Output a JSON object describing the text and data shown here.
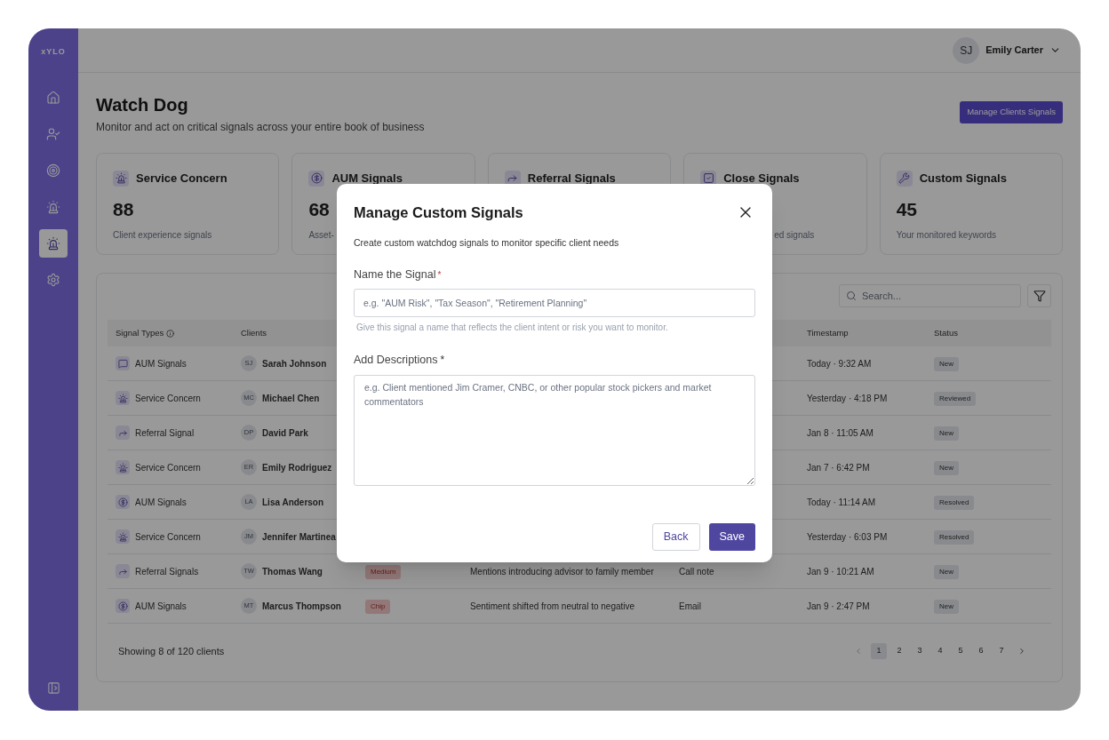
{
  "logo": "xYLO",
  "sidebar": {
    "items": [
      {
        "kind": "home",
        "selected": false
      },
      {
        "kind": "user",
        "selected": false
      },
      {
        "kind": "target",
        "selected": false
      },
      {
        "kind": "siren",
        "selected": false
      },
      {
        "kind": "siren",
        "selected": true
      },
      {
        "kind": "settings",
        "selected": false
      }
    ]
  },
  "user": {
    "initials": "SJ",
    "name": "Emily Carter"
  },
  "page": {
    "title": "Watch Dog",
    "subtitle": "Monitor and act on critical signals across your entire book of business",
    "action": "Manage Clients Signals"
  },
  "cards": [
    {
      "kind": "siren",
      "title": "Service Concern",
      "value": "88",
      "subtitle": "Client experience signals"
    },
    {
      "kind": "dollar",
      "title": "AUM Signals",
      "value": "68",
      "subtitle": "Asset-"
    },
    {
      "kind": "forward",
      "title": "Referral Signals"
    },
    {
      "kind": "square",
      "title": "Close Signals",
      "subtitle": "ed signals"
    },
    {
      "kind": "wrench",
      "title": "Custom Signals",
      "value": "45",
      "subtitle": "Your monitored keywords"
    }
  ],
  "table": {
    "search": {
      "placeholder": "Search..."
    },
    "columns": [
      {
        "label": "Signal Types"
      },
      {
        "label": "Clients"
      },
      {
        "label": "Timestamp"
      },
      {
        "label": "Status"
      }
    ],
    "rows": [
      {
        "signal": {
          "kind": "chat",
          "label": "AUM Signals"
        },
        "initials": "SJ",
        "client": "Sarah Johnson",
        "timestamp": "Today · 9:32 AM",
        "status": "New"
      },
      {
        "signal": {
          "kind": "siren",
          "label": "Service Concern"
        },
        "initials": "MC",
        "client": "Michael Chen",
        "timestamp": "Yesterday · 4:18 PM",
        "status": "Reviewed"
      },
      {
        "signal": {
          "kind": "forward",
          "label": "Referral Signal"
        },
        "initials": "DP",
        "client": "David Park",
        "timestamp": "Jan 8 · 11:05 AM",
        "status": "New"
      },
      {
        "signal": {
          "kind": "siren",
          "label": "Service Concern"
        },
        "initials": "ER",
        "client": "Emily Rodriguez",
        "timestamp": "Jan 7 · 6:42 PM",
        "status": "New"
      },
      {
        "signal": {
          "kind": "dollar",
          "label": "AUM Signals"
        },
        "initials": "LA",
        "client": "Lisa Anderson",
        "timestamp": "Today · 11:14 AM",
        "status": "Resolved"
      },
      {
        "signal": {
          "kind": "siren",
          "label": "Service Concern"
        },
        "initials": "JM",
        "client": "Jennifer Martinea",
        "timestamp": "Yesterday · 6:03 PM",
        "status": "Resolved"
      },
      {
        "signal": {
          "kind": "forward",
          "label": "Referral Signals"
        },
        "initials": "TW",
        "client": "Thomas Wang",
        "chip": "Medium",
        "description": "Mentions introducing advisor to family member",
        "source": "Call note",
        "timestamp": "Jan 9 · 10:21 AM",
        "status": "New"
      },
      {
        "signal": {
          "kind": "dollar",
          "label": "AUM Signals"
        },
        "initials": "MT",
        "client": "Marcus Thompson",
        "chip": "Chip",
        "description": "Sentiment shifted from neutral to negative",
        "source": "Email",
        "timestamp": "Jan 9 · 2:47 PM",
        "status": "New"
      }
    ],
    "footer": "Showing 8 of 120 clients",
    "pagination": {
      "prev": {
        "disabled": true
      },
      "next": {
        "disabled": false
      },
      "pages": [
        {
          "label": "1",
          "selected": true
        },
        {
          "label": "2",
          "selected": false
        },
        {
          "label": "3",
          "selected": false
        },
        {
          "label": "4",
          "selected": false
        },
        {
          "label": "5",
          "selected": false
        },
        {
          "label": "6",
          "selected": false
        },
        {
          "label": "7",
          "selected": false
        }
      ]
    }
  },
  "modal": {
    "title": "Manage Custom Signals",
    "description": "Create custom watchdog signals to monitor specific client needs",
    "name_field": {
      "label": "Name the Signal",
      "required_mark": "*",
      "placeholder": "e.g. \"AUM Risk\", \"Tax Season\", \"Retirement Planning\"",
      "help": "Give this signal a name that reflects the client intent or risk you want to monitor."
    },
    "description_field": {
      "label": "Add Descriptions",
      "required_mark": "*",
      "placeholder": "e.g. Client mentioned Jim Cramer, CNBC, or other popular stock pickers and market commentators"
    },
    "buttons": [
      {
        "kind": "secondary",
        "label": "Back"
      },
      {
        "kind": "primary",
        "label": "Save"
      }
    ]
  }
}
